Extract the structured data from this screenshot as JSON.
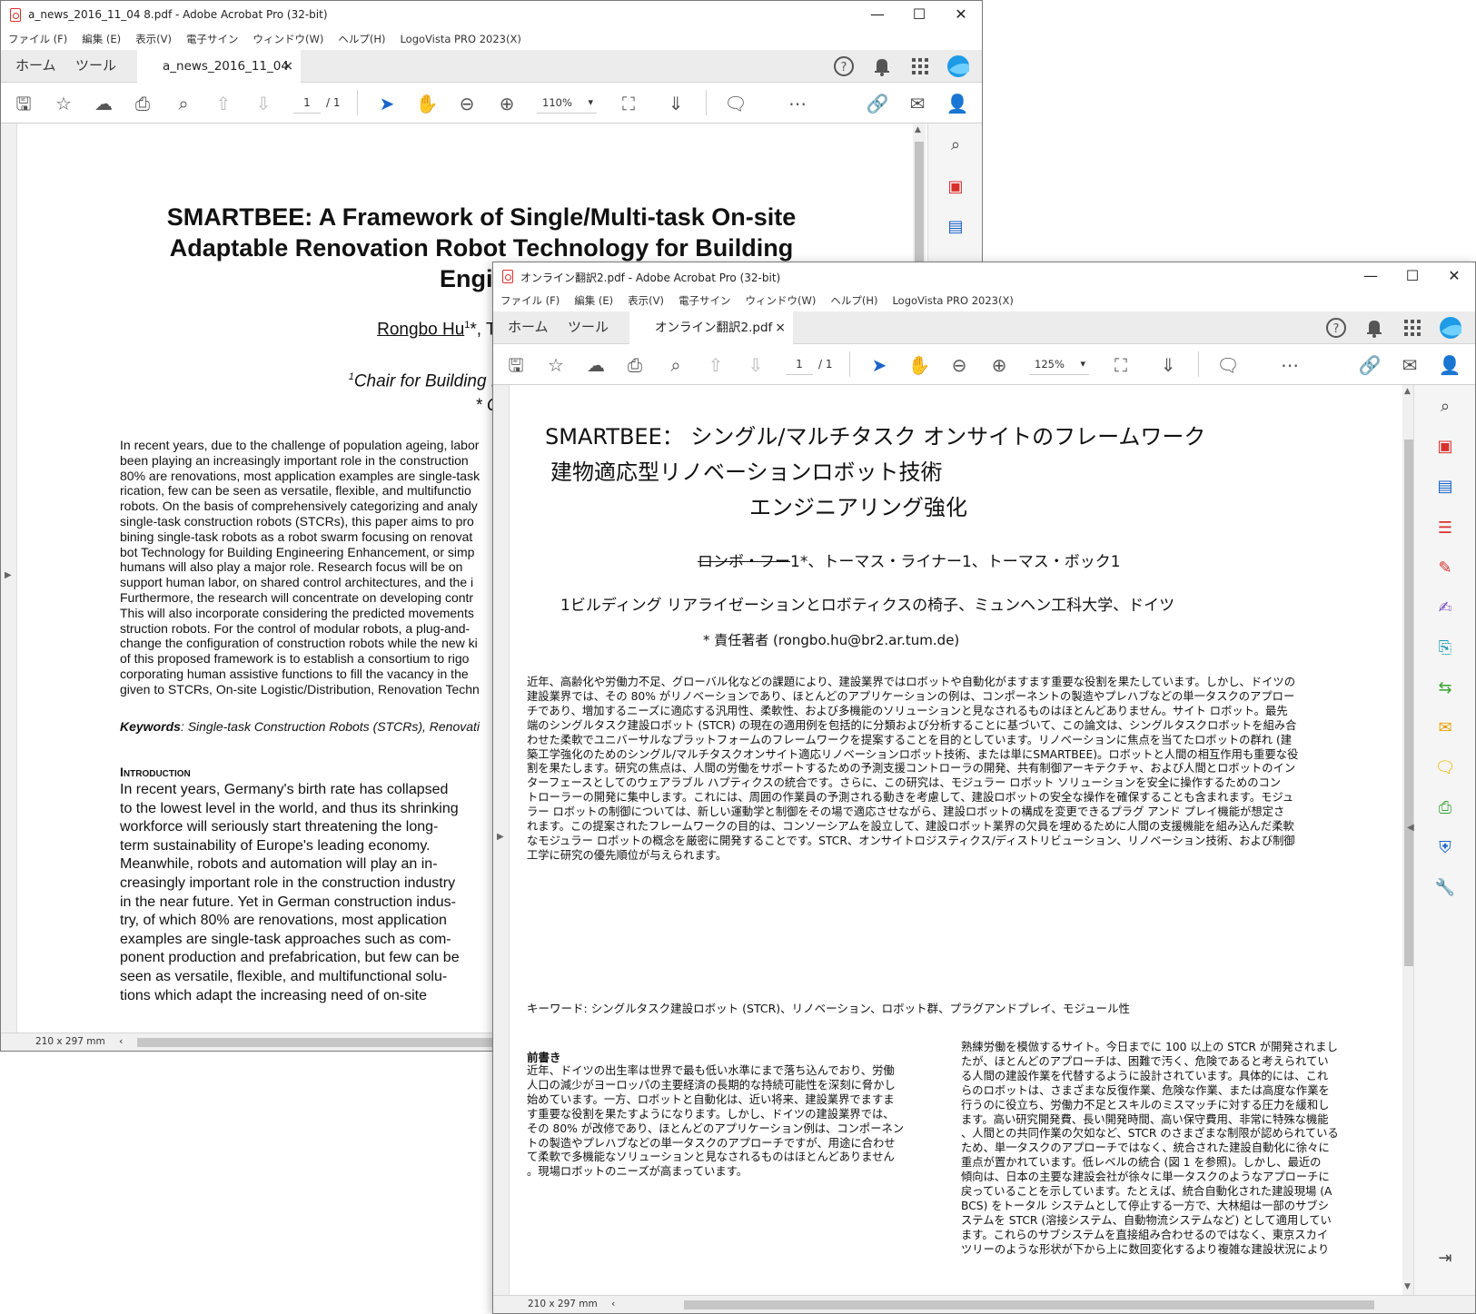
{
  "window1": {
    "title": "a_news_2016_11_04 8.pdf - Adobe Acrobat Pro (32-bit)",
    "menu": [
      "ファイル (F)",
      "編集 (E)",
      "表示(V)",
      "電子サイン",
      "ウィンドウ(W)",
      "ヘルプ(H)",
      "LogoVista PRO 2023(X)"
    ],
    "tabs": {
      "home": "ホーム",
      "tools": "ツール",
      "doc_tab": "a_news_2016_11_04 ...",
      "close": "×"
    },
    "page_current": "1",
    "page_total": "/ 1",
    "zoom": "110%",
    "status_dims": "210 x 297 mm",
    "document": {
      "title_lines": [
        "SMARTBEE: A Framework of Single/Multi-task On-site",
        "Adaptable Renovation Robot Technology for Building",
        "Engineering Er"
      ],
      "author_first": "Rongbo Hu",
      "author_sup": "1",
      "authors_rest": "*, Thomas Linn",
      "affil_sup": "1",
      "affil_line1": "Chair for Building Realization and Robotics,",
      "affil_line2": "* Corresponding author (ron",
      "abstract_lines": [
        "In recent years, due to the challenge of population ageing, labor",
        "been playing an increasingly important role in the construction",
        "80% are renovations, most application examples are single-task",
        "rication, few can be seen as versatile, flexible, and multifunctio",
        "robots. On the basis of comprehensively categorizing and analy",
        "single-task construction robots (STCRs), this paper aims to pro",
        "bining single-task robots as a robot swarm focusing on renovat",
        "bot Technology for Building Engineering Enhancement, or simp",
        "humans will also play a major role. Research focus will be on",
        "support human labor, on shared control architectures, and the i",
        "Furthermore, the research will concentrate on developing contr",
        "This will also incorporate considering the predicted movements",
        "struction robots. For the control of modular robots, a plug-and-",
        "change the configuration of construction robots while the new ki",
        "of this proposed framework is to establish a consortium to rigo",
        "corporating human assistive functions to fill the vacancy in the",
        "given to STCRs, On-site Logistic/Distribution, Renovation Techn"
      ],
      "keywords_label": "Keywords",
      "keywords_text": ": Single-task Construction Robots (STCRs), Renovati",
      "intro_heading": "Introduction",
      "intro_lines": [
        "In recent years, Germany's birth rate has collapsed",
        "to the lowest level in the world, and thus its shrinking",
        "workforce will seriously start threatening the long-",
        "term sustainability of Europe's leading economy.",
        "Meanwhile, robots and automation will play an in-",
        "creasingly important role in the construction industry",
        "in the near future. Yet in German construction indus-",
        "try, of which 80% are renovations, most application",
        "examples are single-task approaches such as com-",
        "ponent production and prefabrication, but few can be",
        "seen as versatile, flexible, and multifunctional solu-",
        "tions which adapt the increasing need of on-site"
      ]
    }
  },
  "window2": {
    "title": "オンライン翻訳2.pdf - Adobe Acrobat Pro (32-bit)",
    "menu": [
      "ファイル (F)",
      "編集 (E)",
      "表示(V)",
      "電子サイン",
      "ウィンドウ(W)",
      "ヘルプ(H)",
      "LogoVista PRO 2023(X)"
    ],
    "tabs": {
      "home": "ホーム",
      "tools": "ツール",
      "doc_tab": "オンライン翻訳2.pdf",
      "close": "×"
    },
    "page_current": "1",
    "page_total": "/ 1",
    "zoom": "125%",
    "status_dims": "210 x 297 mm",
    "document": {
      "title_lines": [
        "SMARTBEE： シングル/マルチタスク オンサイトのフレームワーク",
        "建物適応型リノベーションロボット技術",
        "エンジニアリング強化"
      ],
      "authors_struck": "ロンボ・フー",
      "authors_rest": "1*、トーマス・ライナー1、トーマス・ボック1",
      "affil": "1ビルディング リアライゼーションとロボティクスの椅子、ミュンヘン工科大学、ドイツ",
      "corr": "* 責任著者 (rongbo.hu@br2.ar.tum.de)",
      "abstract_lines": [
        "近年、高齢化や労働力不足、グローバル化などの課題により、建設業界ではロボットや自動化がますます重要な役割を果たしています。しかし、ドイツの",
        "建設業界では、その 80% がリノベーションであり、ほとんどのアプリケーションの例は、コンポーネントの製造やプレハブなどの単一タスクのアプロー",
        "チであり、増加するニーズに適応する汎用性、柔軟性、および多機能のソリューションと見なされるものはほとんどありません。サイト ロボット。最先",
        "端のシングルタスク建設ロボット (STCR) の現在の適用例を包括的に分類および分析することに基づいて、この論文は、シングルタスクロボットを組み合",
        "わせた柔軟でユニバーサルなプラットフォームのフレームワークを提案することを目的としています。リノベーションに焦点を当てたロボットの群れ (建",
        "築工学強化のためのシングル/マルチタスクオンサイト適応リノベーションロボット技術、または単にSMARTBEE)。ロボットと人間の相互作用も重要な役",
        "割を果たします。研究の焦点は、人間の労働をサポートするための予測支援コントローラの開発、共有制御アーキテクチャ、および人間とロボットのイン",
        "ターフェースとしてのウェアラブル ハプティクスの統合です。さらに、この研究は、モジュラー ロボット ソリューションを安全に操作するためのコン",
        "トローラーの開発に集中します。これには、周囲の作業員の予測される動きを考慮して、建設ロボットの安全な操作を確保することも含まれます。モジュ",
        "ラー ロボットの制御については、新しい運動学と制御をその場で適応させながら、建設ロボットの構成を変更できるプラグ アンド プレイ機能が想定さ",
        "れます。この提案されたフレームワークの目的は、コンソーシアムを設立して、建設ロボット業界の欠員を埋めるために人間の支援機能を組み込んだ柔軟",
        "なモジュラー ロボットの概念を厳密に開発することです。STCR、オンサイトロジスティクス/ディストリビューション、リノベーション技術、および制御",
        "工学に研究の優先順位が与えられます。"
      ],
      "keywords": "キーワード: シングルタスク建設ロボット (STCR)、リノベーション、ロボット群、プラグアンドプレイ、モジュール性",
      "intro_heading": "前書き",
      "col1_lines": [
        "近年、ドイツの出生率は世界で最も低い水準にまで落ち込んでおり、労働",
        "人口の減少がヨーロッパの主要経済の長期的な持続可能性を深刻に脅かし",
        "始めています。一方、ロボットと自動化は、近い将来、建設業界でますま",
        "す重要な役割を果たすようになります。しかし、ドイツの建設業界では、",
        "その 80% が改修であり、ほとんどのアプリケーション例は、コンポーネン",
        "トの製造やプレハブなどの単一タスクのアプローチですが、用途に合わせ",
        "て柔軟で多機能なソリューションと見なされるものはほとんどありません",
        "。現場ロボットのニーズが高まっています。"
      ],
      "col2_lines": [
        "熟練労働を模倣するサイト。今日までに 100 以上の STCR が開発されまし",
        "たが、ほとんどのアプローチは、困難で汚く、危険であると考えられてい",
        "る人間の建設作業を代替するように設計されています。具体的には、これ",
        "らのロボットは、さまざまな反復作業、危険な作業、または高度な作業を",
        "行うのに役立ち、労働力不足とスキルのミスマッチに対する圧力を緩和し",
        "ます。高い研究開発費、長い開発時間、高い保守費用、非常に特殊な機能",
        "、人間との共同作業の欠如など、STCR のさまざまな制限が認められている",
        "ため、単一タスクのアプローチではなく、統合された建設自動化に徐々に",
        "重点が置かれています。低レベルの統合 (図 1 を参照)。しかし、最近の",
        "傾向は、日本の主要な建設会社が徐々に単一タスクのようなアプローチに",
        "戻っていることを示しています。たとえば、統合自動化された建設現場 (A",
        "BCS) をトータル システムとして停止する一方で、大林組は一部のサブシ",
        "ステムを STCR (溶接システム、自動物流システムなど) として適用してい",
        "ます。これらのサブシステムを直接組み合わせるのではなく、東京スカイ",
        "ツリーのような形状が下から上に数回変化するより複雑な建設状況により"
      ]
    }
  },
  "colors": {
    "accent_blue": "#1a64c8",
    "pdf_red": "#d9302c",
    "tab_bg": "#ececec"
  }
}
